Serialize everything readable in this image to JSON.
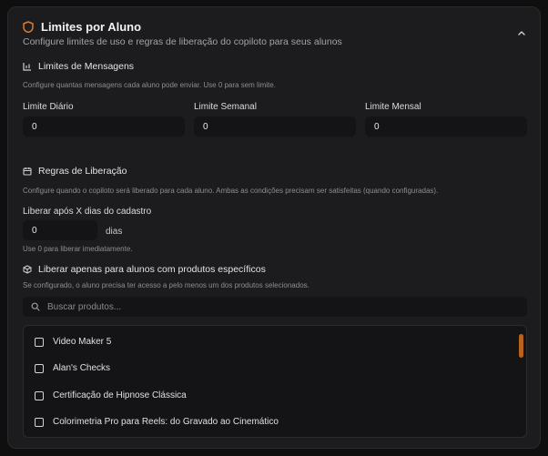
{
  "header": {
    "title": "Limites por Aluno",
    "subtitle": "Configure limites de uso e regras de liberação do copiloto para seus alunos",
    "accent": "#e07a2d"
  },
  "messages": {
    "title": "Limites de Mensagens",
    "help": "Configure quantas mensagens cada aluno pode enviar. Use 0 para sem limite.",
    "daily_label": "Limite Diário",
    "daily_value": "0",
    "weekly_label": "Limite Semanal",
    "weekly_value": "0",
    "monthly_label": "Limite Mensal",
    "monthly_value": "0"
  },
  "release": {
    "title": "Regras de Liberação",
    "help": "Configure quando o copiloto será liberado para cada aluno. Ambas as condições precisam ser satisfeitas (quando configuradas).",
    "days_label": "Liberar após X dias do cadastro",
    "days_value": "0",
    "days_unit": "dias",
    "days_help": "Use 0 para liberar imediatamente.",
    "products_title": "Liberar apenas para alunos com produtos específicos",
    "products_help": "Se configurado, o aluno precisa ter acesso a pelo menos um dos produtos selecionados.",
    "search_placeholder": "Buscar produtos...",
    "products": [
      {
        "label": "Video Maker 5",
        "checked": false
      },
      {
        "label": "Alan's Checks",
        "checked": false
      },
      {
        "label": "Certificação de Hipnose Clássica",
        "checked": false
      },
      {
        "label": "Colorimetria Pro para Reels: do Gravado ao Cinemático",
        "checked": false
      }
    ]
  }
}
